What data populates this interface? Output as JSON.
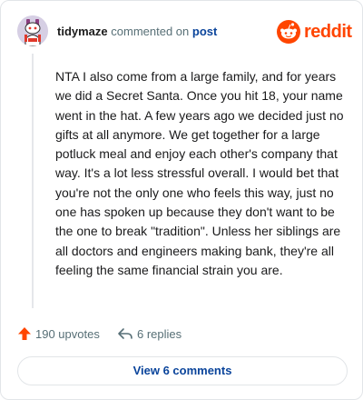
{
  "comment": {
    "author": "tidymaze",
    "action_text": "commented on",
    "target_text": "post",
    "body": "NTA I also come from a large family, and for years we did a Secret Santa. Once you hit 18, your name went in the hat. A few years ago we decided just no gifts at all anymore. We get together for a large potluck meal and enjoy each other's company that way. It's a lot less stressful overall. I would bet that you're not the only one who feels this way, just no one has spoken up because they don't want to be the one to break \"tradition\". Unless her siblings are all doctors and engineers making bank, they're all feeling the same financial strain you are."
  },
  "brand": {
    "wordmark": "reddit",
    "icon": "reddit-snoo-icon",
    "color": "#ff4500"
  },
  "stats": {
    "upvotes_label": "190 upvotes",
    "upvote_icon": "upvote-arrow-icon",
    "upvote_color": "#ff4500",
    "replies_label": "6 replies",
    "reply_icon": "reply-arrow-icon"
  },
  "actions": {
    "view_comments_label": "View 6 comments"
  }
}
